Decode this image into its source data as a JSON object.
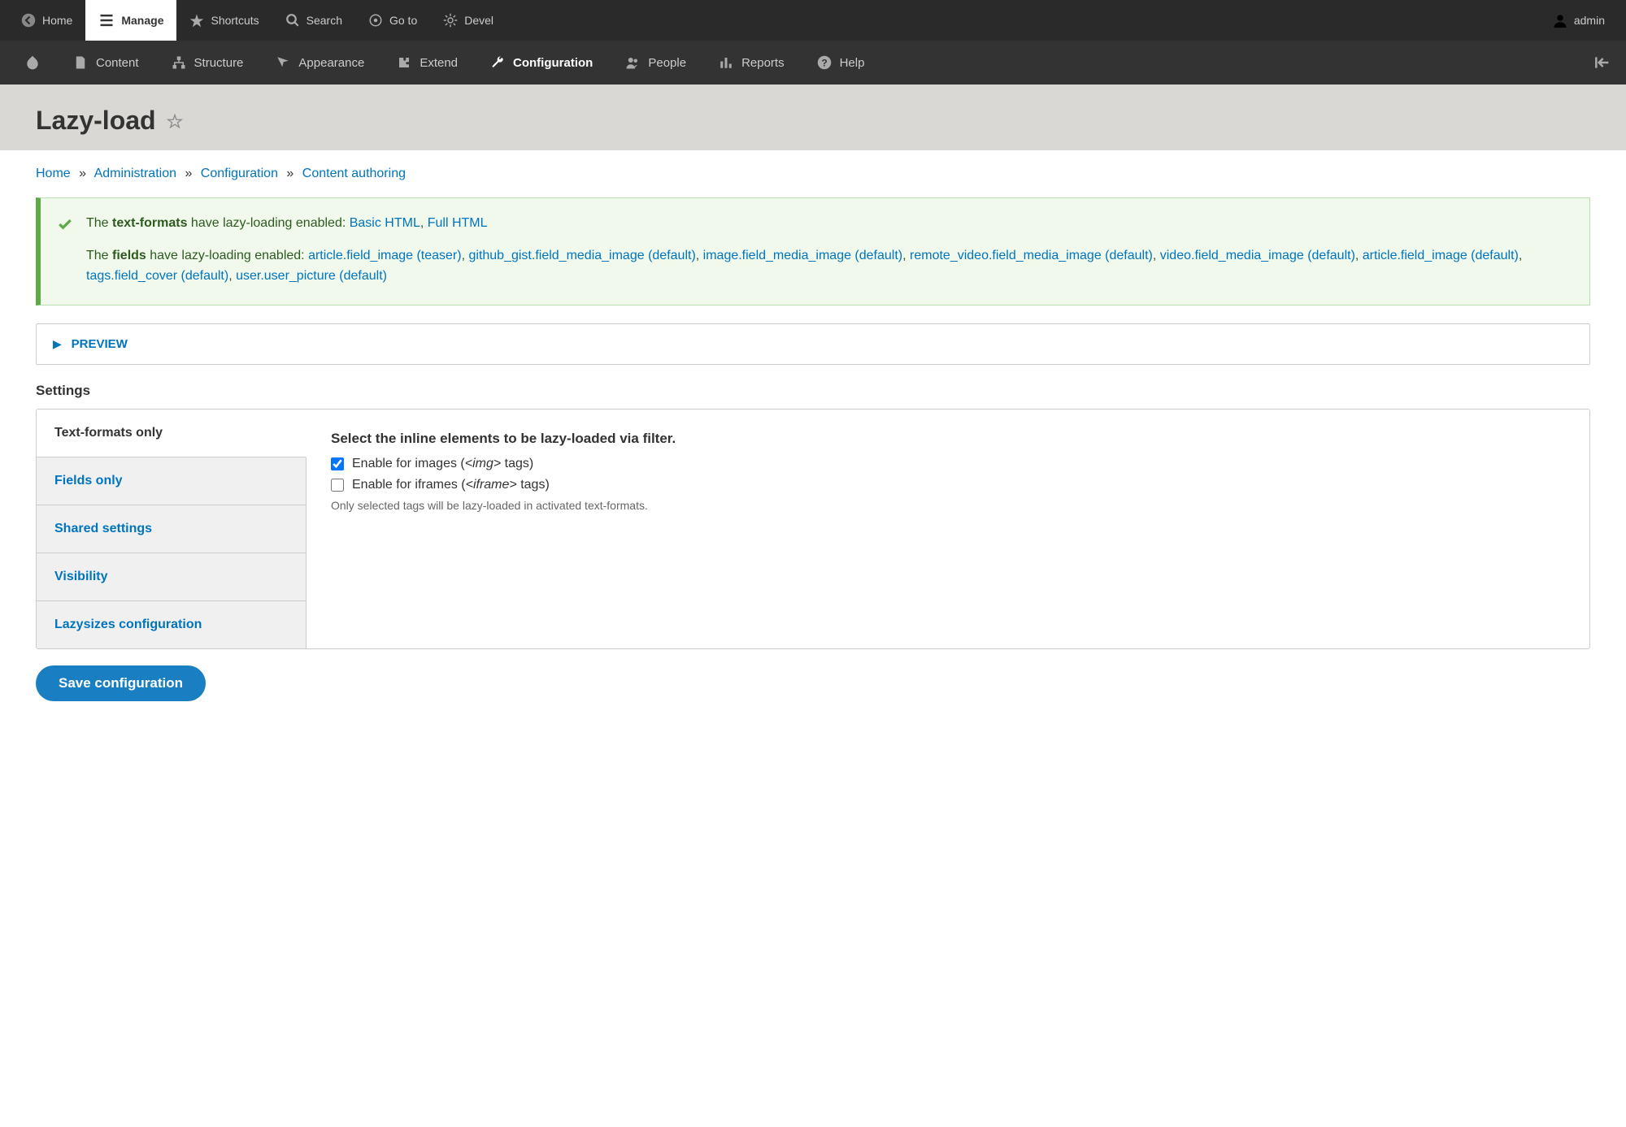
{
  "toolbar_top": {
    "home": "Home",
    "manage": "Manage",
    "shortcuts": "Shortcuts",
    "search": "Search",
    "goto": "Go to",
    "devel": "Devel",
    "user": "admin"
  },
  "toolbar_sub": {
    "content": "Content",
    "structure": "Structure",
    "appearance": "Appearance",
    "extend": "Extend",
    "configuration": "Configuration",
    "people": "People",
    "reports": "Reports",
    "help": "Help"
  },
  "page_title": "Lazy-load",
  "breadcrumb": {
    "home": "Home",
    "admin": "Administration",
    "config": "Configuration",
    "authoring": "Content authoring"
  },
  "message": {
    "line1_pre": "The ",
    "line1_bold": "text-formats",
    "line1_post": " have lazy-loading enabled: ",
    "text_formats": [
      "Basic HTML",
      "Full HTML"
    ],
    "line2_pre": "The ",
    "line2_bold": "fields",
    "line2_post": " have lazy-loading enabled: ",
    "fields": [
      "article.field_image (teaser)",
      "github_gist.field_media_image (default)",
      "image.field_media_image (default)",
      "remote_video.field_media_image (default)",
      "video.field_media_image (default)",
      "article.field_image (default)",
      "tags.field_cover (default)",
      "user.user_picture (default)"
    ]
  },
  "preview_label": "PREVIEW",
  "settings_heading": "Settings",
  "vtabs": {
    "text_formats": "Text-formats only",
    "fields_only": "Fields only",
    "shared": "Shared settings",
    "visibility": "Visibility",
    "lazysizes": "Lazysizes configuration"
  },
  "tab_content": {
    "section_title": "Select the inline elements to be lazy-loaded via filter.",
    "chk_images_pre": "Enable for images (",
    "chk_images_tag": "<img>",
    "chk_images_post": " tags)",
    "chk_images_checked": true,
    "chk_iframes_pre": "Enable for iframes (",
    "chk_iframes_tag": "<iframe>",
    "chk_iframes_post": " tags)",
    "chk_iframes_checked": false,
    "description": "Only selected tags will be lazy-loaded in activated text-formats."
  },
  "save_button": "Save configuration"
}
